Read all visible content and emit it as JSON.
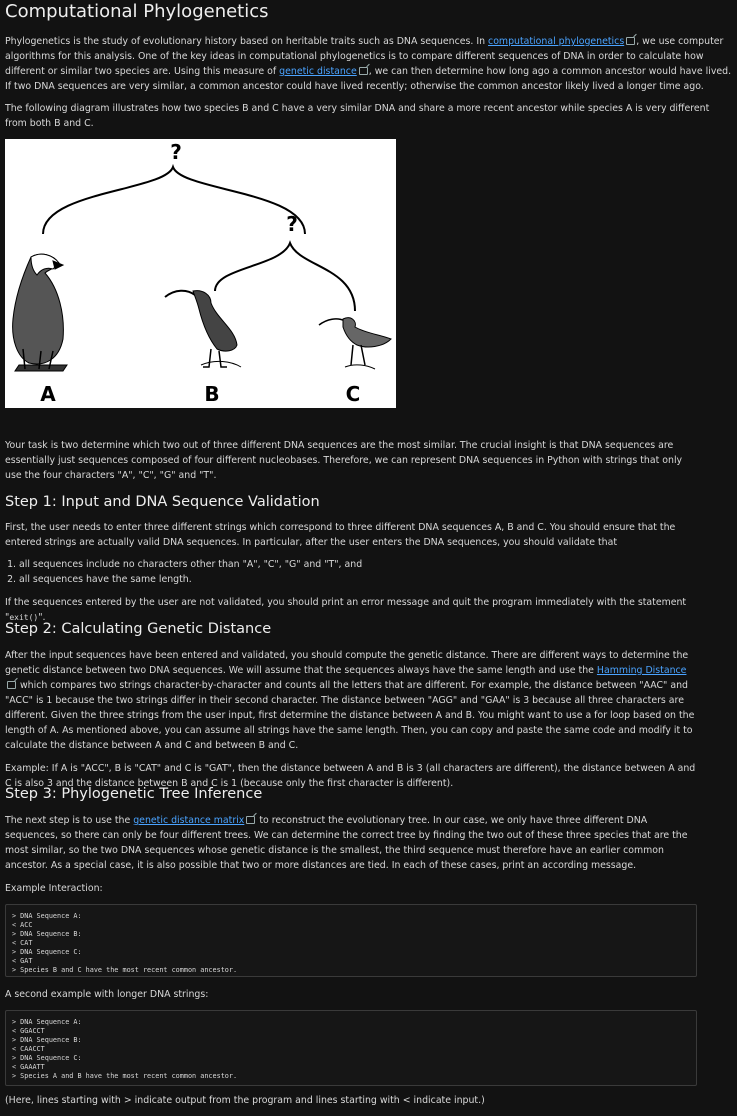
{
  "title": "Computational Phylogenetics",
  "intro": {
    "p1_a": "Phylogenetics is the study of evolutionary history based on heritable traits such as DNA sequences. In ",
    "p1_link1": "computational phylogenetics",
    "p1_b": ", we use computer algorithms for this analysis. One of the key ideas in computational phylogenetics is to compare different sequences of DNA in order to calculate how different or similar two species are. Using this measure of ",
    "p1_link2": "genetic distance",
    "p1_c": ", we can then determine how long ago a common ancestor would have lived. If two DNA sequences are very similar, a common ancestor could have lived recently; otherwise the common ancestor likely lived a longer time ago.",
    "p2": "The following diagram illustrates how two species B and C have a very similar DNA and share a more recent ancestor while species A is very different from both B and C."
  },
  "diagram": {
    "question_top": "?",
    "question_mid": "?",
    "label_a": "A",
    "label_b": "B",
    "label_c": "C",
    "species_a_icon": "eagle-illustration",
    "species_b_icon": "ibis-illustration",
    "species_c_icon": "curlew-illustration"
  },
  "task": "Your task is two determine which two out of three different DNA sequences are the most similar. The crucial insight is that DNA sequences are essentially just sequences composed of four different nucleobases. Therefore, we can represent DNA sequences in Python with strings that only use the four characters \"A\", \"C\", \"G\" and \"T\".",
  "step1": {
    "heading": "Step 1: Input and DNA Sequence Validation",
    "p": "First, the user needs to enter three different strings which correspond to three different DNA sequences A, B and C. You should ensure that the entered strings are actually valid DNA sequences. In particular, after the user enters the DNA sequences, you should validate that",
    "items": [
      "all sequences include no characters other than \"A\", \"C\", \"G\" and \"T\", and",
      "all sequences have the same length."
    ],
    "note_a": "If the sequences entered by the user are not validated, you should print an error message and quit the program immediately with the statement \"",
    "note_code": "exit()",
    "note_b": "\"."
  },
  "step2": {
    "heading": "Step 2: Calculating Genetic Distance",
    "p_a": "After the input sequences have been entered and validated, you should compute the genetic distance. There are different ways to determine the genetic distance between two DNA sequences. We will assume that the sequences always have the same length and use the ",
    "p_link": "Hamming Distance",
    "p_b": " which compares two strings character-by-character and counts all the letters that are different. For example, the distance between \"AAC\" and \"ACC\" is 1 because the two strings differ in their second character. The distance between \"AGG\" and \"GAA\" is 3 because all three characters are different. Given the three strings from the user input, first determine the distance between A and B. You might want to use a for loop based on the length of A. As mentioned above, you can assume all strings have the same length. Then, you can copy and paste the same code and modify it to calculate the distance between A and C and between B and C.",
    "example": "Example: If A is \"ACC\", B is \"CAT\" and C is \"GAT\", then the distance between A and B is 3 (all characters are different), the distance between A and C is also 3 and the distance between B and C is 1 (because only the first character is different)."
  },
  "step3": {
    "heading": "Step 3: Phylogenetic Tree Inference",
    "p_a": "The next step is to use the ",
    "p_link": "genetic distance matrix",
    "p_b": " to reconstruct the evolutionary tree. In our case, we only have three different DNA sequences, so there can only be four different trees. We can determine the correct tree by finding the two out of these three species that are the most similar, so the two DNA sequences whose genetic distance is the smallest, the third sequence must therefore have an earlier common ancestor. As a special case, it is also possible that two or more distances are tied. In each of these cases, print an according message.",
    "example_label": "Example Interaction:",
    "example1": [
      "> DNA Sequence A:",
      "< ACC",
      "> DNA Sequence B:",
      "< CAT",
      "> DNA Sequence C:",
      "< GAT",
      "> Species B and C have the most recent common ancestor."
    ],
    "second_label": "A second example with longer DNA strings:",
    "example2": [
      "> DNA Sequence A:",
      "< GGACCT",
      "> DNA Sequence B:",
      "< CAACCT",
      "> DNA Sequence C:",
      "< GAAATT",
      "> Species A and B have the most recent common ancestor."
    ],
    "footer": "(Here, lines starting with > indicate output from the program and lines starting with < indicate input.)"
  }
}
